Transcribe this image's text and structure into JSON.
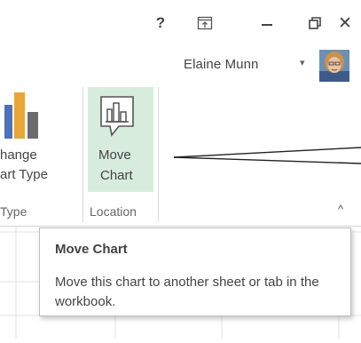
{
  "titlebar": {
    "help_label": "?",
    "help_icon": "question-icon",
    "ribbon_display_icon": "ribbon-display-options-icon",
    "minimize_icon": "minimize-icon",
    "maximize_icon": "restore-window-icon",
    "close_label": "✕",
    "close_icon": "close-icon",
    "user_name": "Elaine Munn",
    "user_caret": "▾"
  },
  "ribbon": {
    "change_chart_type": {
      "line1": "hange",
      "line2": "art Type",
      "icon": "change-chart-type-icon"
    },
    "type_group_label": "Type",
    "move_chart": {
      "line1": "Move",
      "line2": "Chart",
      "icon": "move-chart-icon"
    },
    "location_group_label": "Location",
    "collapse_label": "^",
    "collapse_icon": "collapse-ribbon-icon",
    "accent": "#d8ecde"
  },
  "tooltip": {
    "title": "Move Chart",
    "body": "Move this chart to another sheet or tab in the workbook."
  }
}
